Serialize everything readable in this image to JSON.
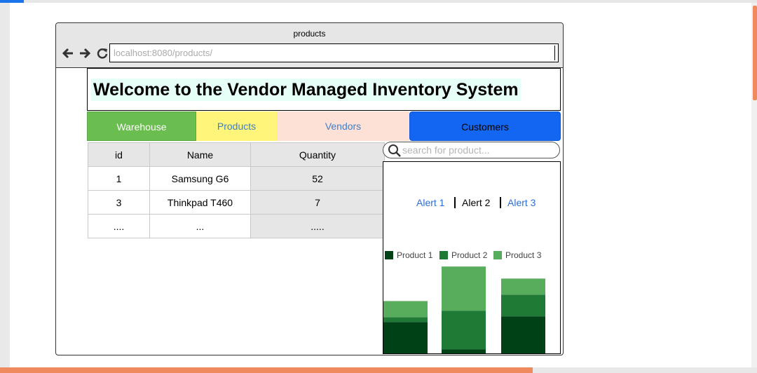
{
  "browser": {
    "tab_title": "products",
    "url": "localhost:8080/products/"
  },
  "page": {
    "welcome_title": "Welcome to the Vendor Managed Inventory System"
  },
  "nav": {
    "items": [
      {
        "label": "Warehouse"
      },
      {
        "label": "Products"
      },
      {
        "label": "Vendors"
      },
      {
        "label": "Customers"
      }
    ]
  },
  "table": {
    "headers": [
      "id",
      "Name",
      "Quantity"
    ],
    "rows": [
      [
        "1",
        "Samsung G6",
        "52"
      ],
      [
        "3",
        "Thinkpad T460",
        "7"
      ],
      [
        "....",
        "...",
        "....."
      ]
    ]
  },
  "search": {
    "placeholder": "search for product..."
  },
  "alerts": {
    "items": [
      "Alert 1",
      "Alert 2",
      "Alert 3"
    ]
  },
  "colors": {
    "product_1": "#004216",
    "product_2": "#1e7a35",
    "product_3": "#58ad5c"
  },
  "chart_data": {
    "type": "bar",
    "stacked": true,
    "categories": [
      "",
      "",
      ""
    ],
    "series": [
      {
        "name": "Product 1",
        "values": [
          40,
          6,
          47
        ]
      },
      {
        "name": "Product 2",
        "values": [
          6,
          48,
          27
        ]
      },
      {
        "name": "Product 3",
        "values": [
          20,
          55,
          20
        ]
      }
    ],
    "ylim": [
      0,
      110
    ],
    "grid": false,
    "legend": "top"
  }
}
